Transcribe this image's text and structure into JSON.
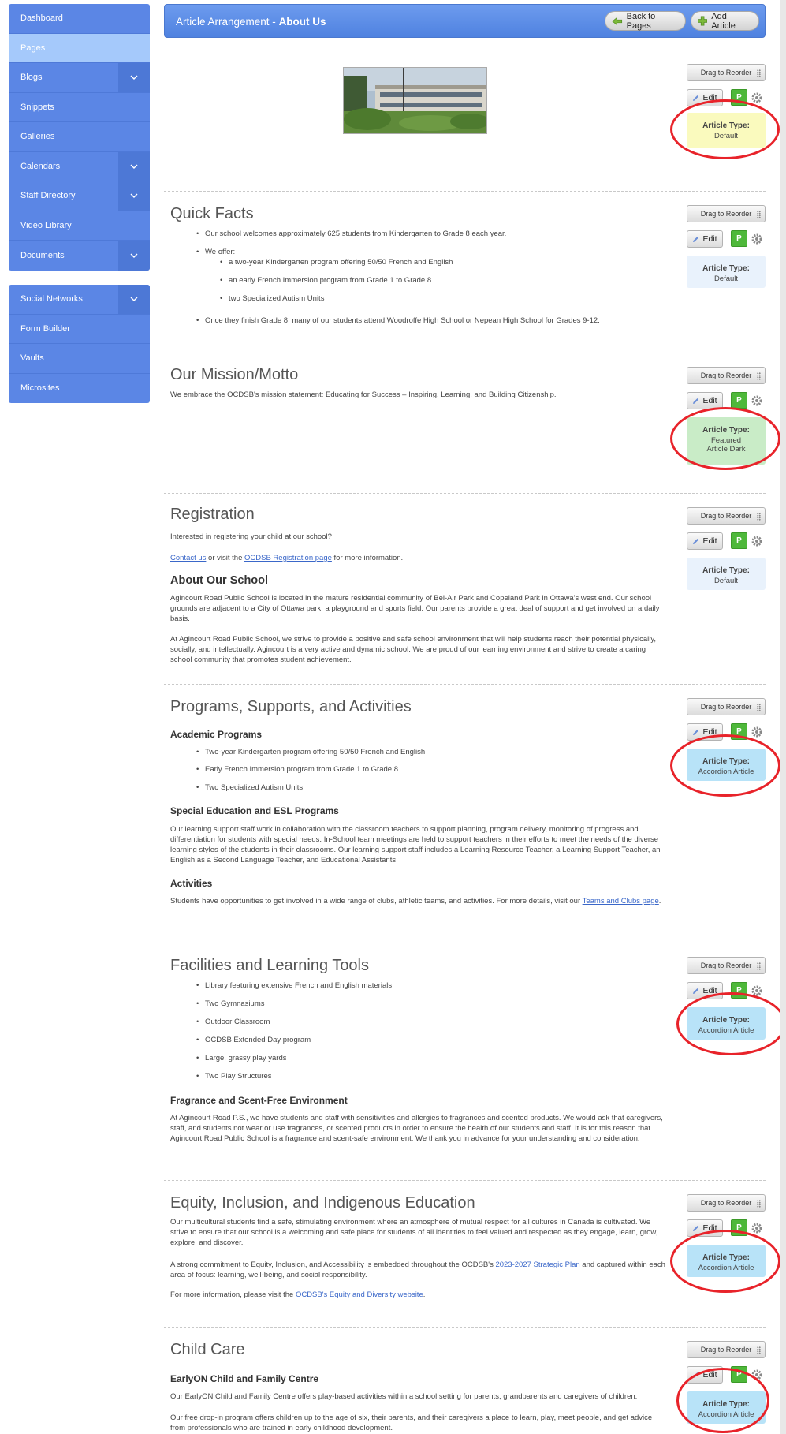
{
  "sidebar": {
    "groups": [
      [
        {
          "label": "Dashboard",
          "active": false,
          "expandable": false
        },
        {
          "label": "Pages",
          "active": true,
          "expandable": false
        },
        {
          "label": "Blogs",
          "active": false,
          "expandable": true
        },
        {
          "label": "Snippets",
          "active": false,
          "expandable": false
        },
        {
          "label": "Galleries",
          "active": false,
          "expandable": false
        },
        {
          "label": "Calendars",
          "active": false,
          "expandable": true
        },
        {
          "label": "Staff Directory",
          "active": false,
          "expandable": true
        },
        {
          "label": "Video Library",
          "active": false,
          "expandable": false
        },
        {
          "label": "Documents",
          "active": false,
          "expandable": true
        }
      ],
      [
        {
          "label": "Social Networks",
          "active": false,
          "expandable": true
        },
        {
          "label": "Form Builder",
          "active": false,
          "expandable": false
        },
        {
          "label": "Vaults",
          "active": false,
          "expandable": false
        },
        {
          "label": "Microsites",
          "active": false,
          "expandable": false
        }
      ]
    ]
  },
  "header": {
    "title_prefix": "Article Arrangement - ",
    "title_page": "About Us",
    "back_label": "Back to Pages",
    "add_label": "Add Article"
  },
  "controls": {
    "drag_label": "Drag to Reorder",
    "edit_label": "Edit",
    "publish_label": "P",
    "type_label": "Article Type:"
  },
  "types": {
    "default": "Default",
    "featured_dark": "Featured Article Dark",
    "accordion": "Accordion Article"
  },
  "articles": {
    "quick_facts": {
      "title": "Quick Facts",
      "b1": "Our school welcomes approximately 625 students from Kindergarten to Grade 8 each year.",
      "b2": "We offer:",
      "b2a": "a two-year Kindergarten program offering 50/50 French and English",
      "b2b": "an early French Immersion program from Grade 1 to Grade 8",
      "b2c": "two Specialized Autism Units",
      "b3": "Once they finish Grade 8, many of our students attend Woodroffe High School or Nepean High School for Grades 9-12."
    },
    "mission": {
      "title": "Our Mission/Motto",
      "text": "We embrace the OCDSB's mission statement: Educating for Success – Inspiring, Learning, and Building Citizenship."
    },
    "registration": {
      "title": "Registration",
      "p1": "Interested in registering your child at our school?",
      "contact_link": "Contact us",
      "p2_mid": " or visit the ",
      "reg_link": "OCDSB Registration page",
      "p2_end": " for more information.",
      "about_title": "About Our School",
      "about_p1": "Agincourt Road Public School is located in the mature residential community of Bel-Air Park and Copeland Park in Ottawa's west end. Our school grounds are adjacent to a City of Ottawa park, a playground and sports field. Our parents provide a great deal of support and get involved on a daily basis.",
      "about_p2": "At Agincourt Road Public School, we strive to provide a positive and safe school environment that will help students reach their potential physically, socially, and intellectually. Agincourt is a very active and dynamic school. We are proud of our learning environment and strive to create a caring school community that promotes student achievement."
    },
    "programs": {
      "title": "Programs, Supports, and Activities",
      "h_academic": "Academic Programs",
      "a1": "Two-year Kindergarten program offering 50/50 French and English",
      "a2": "Early French Immersion program from Grade 1 to Grade 8",
      "a3": "Two Specialized Autism Units",
      "h_special": "Special Education and ESL Programs",
      "special_text": "Our learning support staff work in collaboration with the classroom teachers to support planning, program delivery, monitoring of progress and differentiation for students with special needs. In-School team meetings are held to support teachers in their efforts to meet the needs of the diverse learning styles of the students in their classrooms. Our learning support staff includes a Learning Resource Teacher, a Learning Support Teacher, an English as a Second Language Teacher, and Educational Assistants.",
      "h_activities": "Activities",
      "activities_text": "Students have opportunities to get involved in a wide range of clubs, athletic teams, and activities. For more details, visit our ",
      "activities_link": "Teams and Clubs page",
      "activities_end": "."
    },
    "facilities": {
      "title": "Facilities and Learning Tools",
      "f1": "Library featuring extensive French and English materials",
      "f2": "Two Gymnasiums",
      "f3": "Outdoor Classroom",
      "f4": "OCDSB Extended Day program",
      "f5": "Large, grassy play yards",
      "f6": "Two Play Structures",
      "h_fragrance": "Fragrance and Scent-Free Environment",
      "fragrance_text": "At Agincourt Road P.S., we have students and staff with sensitivities and allergies to fragrances and scented products. We would ask that caregivers, staff, and students not wear or use fragrances, or scented products in order to ensure the health of our students and staff. It is for this reason that Agincourt Road Public School is a fragrance and scent-safe environment. We thank you in advance for your understanding and consideration."
    },
    "equity": {
      "title": "Equity, Inclusion, and Indigenous Education",
      "p1": "Our multicultural students find a safe, stimulating environment where an atmosphere of mutual respect for all cultures in Canada is cultivated. We strive to ensure that our school is a welcoming and safe place for students of all identities to feel valued and respected as they engage, learn, grow, explore, and discover.",
      "p2_start": "A strong commitment to Equity, Inclusion, and Accessibility is embedded throughout the OCDSB's ",
      "plan_link": "2023-2027 Strategic Plan",
      "p2_end": " and captured within each area of focus: learning, well-being, and social responsibility.",
      "p3_start": "For more information, please visit the ",
      "equity_link": "OCDSB's Equity and Diversity website",
      "p3_end": "."
    },
    "childcare": {
      "title": "Child Care",
      "h_early": "EarlyON Child and Family Centre",
      "p1": "Our EarlyON Child and Family Centre offers play-based activities within a school setting for parents, grandparents and caregivers of children.",
      "p2": "Our free drop-in program offers children up to the age of six, their parents, and their caregivers a place to learn, play, meet people, and get advice from professionals who are trained in early childhood development."
    }
  },
  "colors": {
    "sidebar": "#5b86e5",
    "sidebar_active": "#a5c9fb",
    "header": "#4f82e0",
    "highlight_ring": "#e8232a",
    "publish_green": "#4eb83a"
  },
  "icons": {
    "chevron": "chevron-down-icon",
    "back": "arrow-left-icon",
    "add": "plus-icon",
    "edit": "pencil-icon",
    "settings": "gear-icon",
    "drag": "drag-handle-icon"
  }
}
